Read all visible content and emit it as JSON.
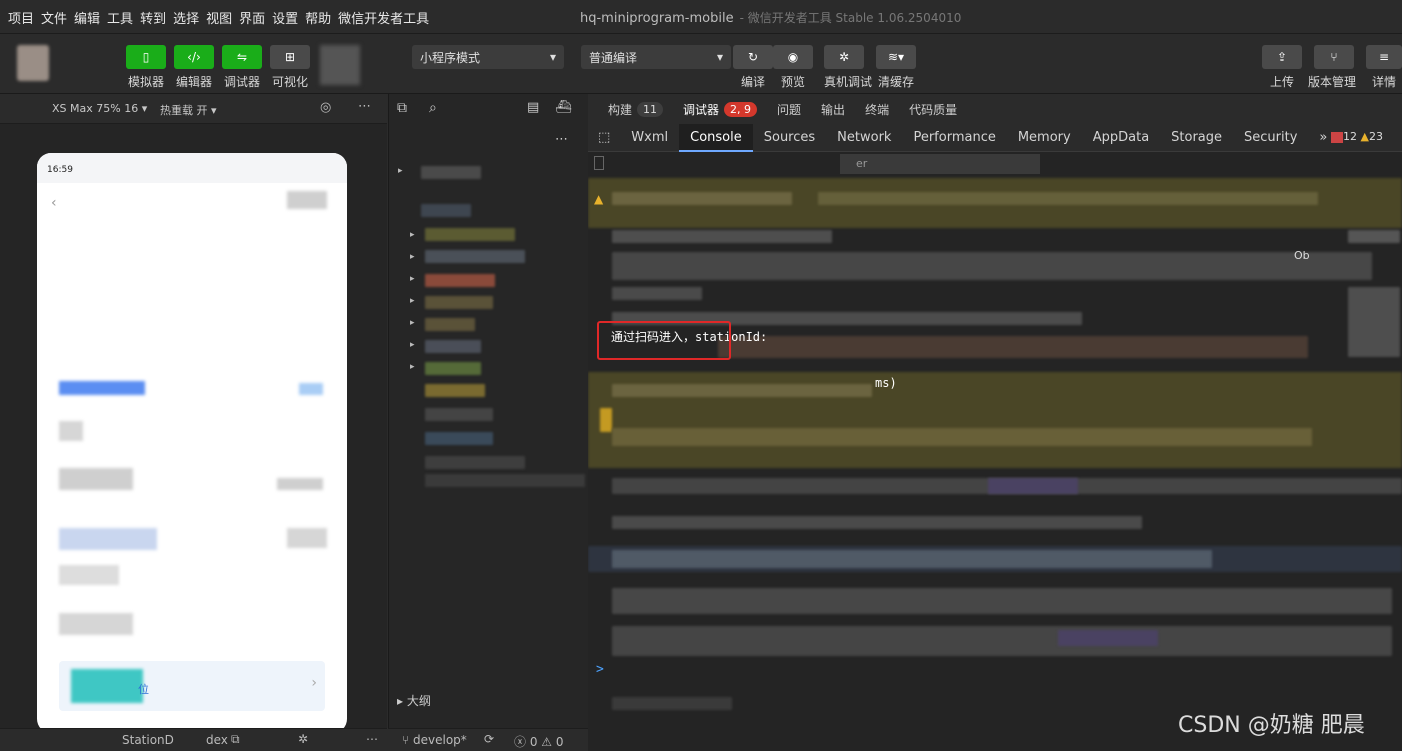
{
  "menu": [
    "项目",
    "文件",
    "编辑",
    "工具",
    "转到",
    "选择",
    "视图",
    "界面",
    "设置",
    "帮助",
    "微信开发者工具"
  ],
  "window": {
    "title": "hq-miniprogram-mobile",
    "subtitle": "- 微信开发者工具 Stable 1.06.2504010"
  },
  "toolbar": {
    "simulator": "模拟器",
    "editor": "编辑器",
    "debugger": "调试器",
    "visual": "可视化",
    "mode_select": "小程序模式",
    "compile_select": "普通编译",
    "compile": "编译",
    "preview": "预览",
    "real_debug": "真机调试",
    "clear_cache": "清缓存",
    "upload": "上传",
    "version": "版本管理",
    "details": "详情"
  },
  "simulator": {
    "device": "XS Max 75% 16",
    "hot_reload": "热重载 开",
    "time": "16:59",
    "bottom_item": "位",
    "footer_path": "StationD",
    "footer_path2": "dex"
  },
  "explorer": {
    "footer_branch": "develop*",
    "footer_errors": "0",
    "footer_warnings": "0",
    "outline": "大纲"
  },
  "debug_tabs": {
    "build": "构建",
    "build_count": "11",
    "debugger": "调试器",
    "debugger_count": "2, 9",
    "issues": "问题",
    "output": "输出",
    "terminal": "终端",
    "code_quality": "代码质量"
  },
  "devtools_tabs": [
    "Wxml",
    "Console",
    "Sources",
    "Network",
    "Performance",
    "Memory",
    "AppData",
    "Storage",
    "Security"
  ],
  "devtools_counts": {
    "errors": "12",
    "warnings": "23"
  },
  "console": {
    "highlighted_log": "通过扫码进入，stationId:",
    "timing_fragment": "ms)",
    "filter_placeholder": "er",
    "right_fragment": "Ob",
    "prompt": ">"
  },
  "watermark": "CSDN @奶糖 肥晨"
}
